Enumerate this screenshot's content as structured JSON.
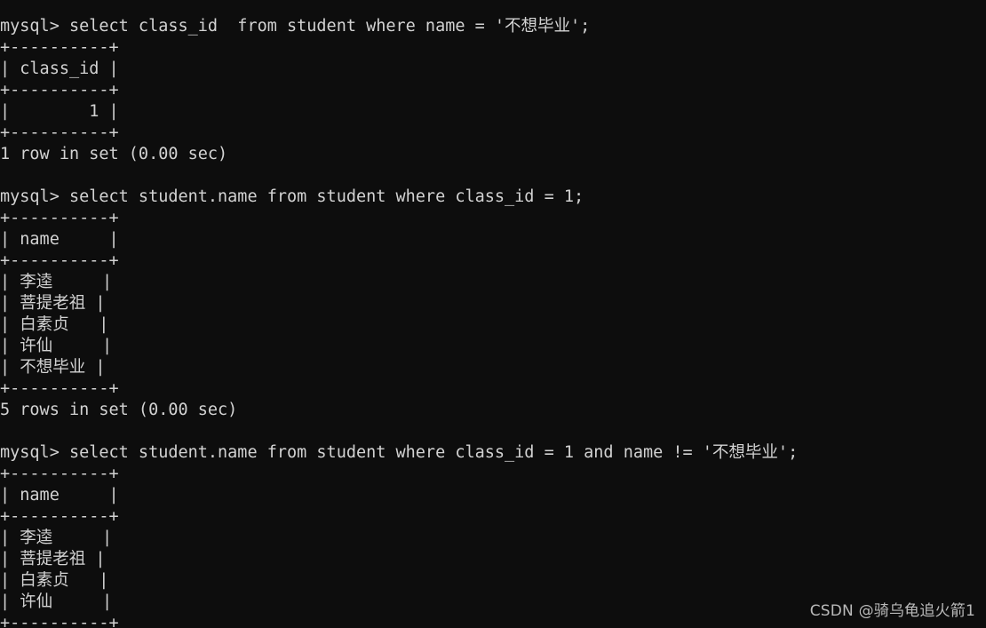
{
  "window": {
    "title": "mysql client terminal",
    "background_color": "#0d0d0d",
    "foreground_color": "#d2d2d2"
  },
  "terminal": {
    "prompt": "mysql>",
    "lines": [
      "mysql> select class_id  from student where name = '不想毕业';",
      "+----------+",
      "| class_id |",
      "+----------+",
      "|        1 |",
      "+----------+",
      "1 row in set (0.00 sec)",
      "",
      "mysql> select student.name from student where class_id = 1;",
      "+----------+",
      "| name     |",
      "+----------+",
      "| 李逵     |",
      "| 菩提老祖 |",
      "| 白素贞   |",
      "| 许仙     |",
      "| 不想毕业 |",
      "+----------+",
      "5 rows in set (0.00 sec)",
      "",
      "mysql> select student.name from student where class_id = 1 and name != '不想毕业';",
      "+----------+",
      "| name     |",
      "+----------+",
      "| 李逵     |",
      "| 菩提老祖 |",
      "| 白素贞   |",
      "| 许仙     |",
      "+----------+"
    ],
    "queries": [
      {
        "sql": "select class_id  from student where name = '不想毕业';",
        "columns": [
          "class_id"
        ],
        "rows": [
          [
            "1"
          ]
        ],
        "status": "1 row in set (0.00 sec)"
      },
      {
        "sql": "select student.name from student where class_id = 1;",
        "columns": [
          "name"
        ],
        "rows": [
          [
            "李逵"
          ],
          [
            "菩提老祖"
          ],
          [
            "白素贞"
          ],
          [
            "许仙"
          ],
          [
            "不想毕业"
          ]
        ],
        "status": "5 rows in set (0.00 sec)"
      },
      {
        "sql": "select student.name from student where class_id = 1 and name != '不想毕业';",
        "columns": [
          "name"
        ],
        "rows": [
          [
            "李逵"
          ],
          [
            "菩提老祖"
          ],
          [
            "白素贞"
          ],
          [
            "许仙"
          ]
        ],
        "status": ""
      }
    ]
  },
  "watermark": {
    "text": "CSDN @骑乌龟追火箭1"
  }
}
